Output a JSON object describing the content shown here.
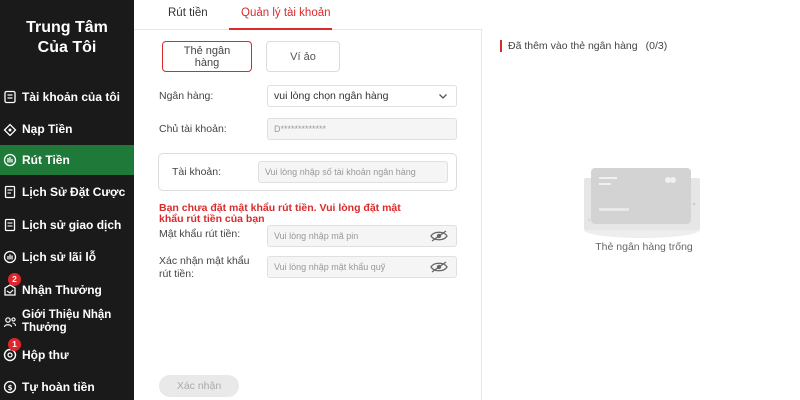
{
  "sidebar": {
    "title_line1": "Trung Tâm",
    "title_line2": "Của Tôi",
    "items": [
      {
        "label": "Tài khoản của tôi",
        "icon": "account-icon"
      },
      {
        "label": "Nạp Tiền",
        "icon": "deposit-icon"
      },
      {
        "label": "Rút Tiền",
        "icon": "withdraw-icon",
        "active": true
      },
      {
        "label": "Lịch Sử Đặt Cược",
        "icon": "bet-history-icon"
      },
      {
        "label": "Lịch sử giao dịch",
        "icon": "transaction-history-icon"
      },
      {
        "label": "Lịch sử lãi lỗ",
        "icon": "profit-loss-icon"
      },
      {
        "label": "Nhận Thưởng",
        "icon": "reward-icon",
        "badge": "2"
      },
      {
        "label_line1": "Giới Thiệu Nhận",
        "label_line2": "Thưởng",
        "icon": "referral-icon"
      },
      {
        "label": "Hộp thư",
        "icon": "mail-icon",
        "badge": "1"
      },
      {
        "label": "Tự hoàn tiền",
        "icon": "refund-icon"
      }
    ]
  },
  "tabs": {
    "withdraw": "Rút tiền",
    "manage": "Quản lý tài khoản"
  },
  "subtabs": {
    "bank_line1": "Thẻ ngân",
    "bank_line2": "hàng",
    "ewallet": "Ví ảo"
  },
  "form": {
    "bank_label": "Ngân hàng:",
    "bank_value": "vui lòng chọn ngân hàng",
    "holder_label": "Chủ tài khoản:",
    "holder_value": "D*************",
    "account_label": "Tài khoản:",
    "account_placeholder": "Vui lòng nhập số tài khoản ngân hàng",
    "warning_line1": "Bạn chưa đặt mật khẩu rút tiền. Vui lòng đặt mật",
    "warning_line2": "khẩu rút tiền của bạn",
    "pin_label": "Mật khẩu rút tiền:",
    "pin_placeholder": "Vui lòng nhập mã pin",
    "confirm_label_line1": "Xác nhận mật khẩu",
    "confirm_label_line2": "rút tiền:",
    "confirm_placeholder": "Vui lòng nhập mật khẩu quỹ",
    "submit": "Xác nhận"
  },
  "right": {
    "heading": "Đã thêm vào thẻ ngân hàng",
    "count": "(0/3)",
    "empty": "Thẻ ngân hàng trống"
  },
  "colors": {
    "accent": "#d92b2b",
    "sidebar_bg": "#1a1a1a",
    "active_item": "#1f7a3a"
  }
}
